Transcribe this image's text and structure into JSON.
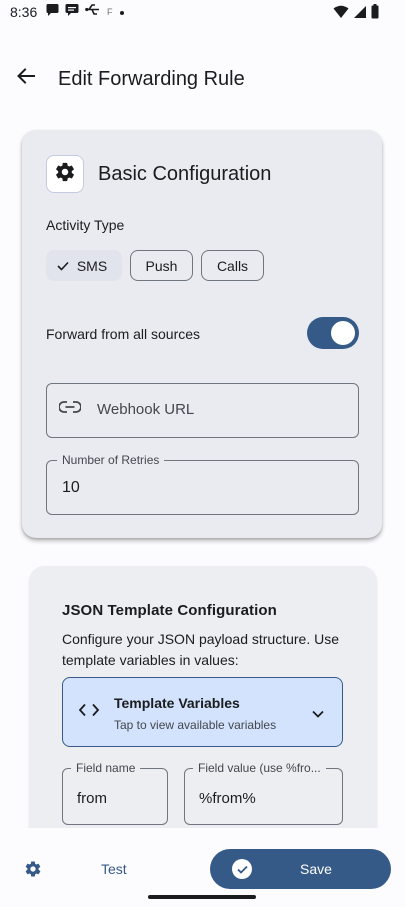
{
  "status_bar": {
    "time": "8:36",
    "left_icons": [
      "sms-icon",
      "chat-icon",
      "usb-icon",
      "f-icon",
      "dot-icon"
    ],
    "right_icons": [
      "wifi-icon",
      "signal-icon",
      "battery-icon"
    ]
  },
  "app_bar": {
    "title": "Edit Forwarding Rule",
    "back_icon": "arrow-back-icon"
  },
  "basic_config": {
    "title": "Basic Configuration",
    "icon": "gear-icon",
    "activity_type_label": "Activity Type",
    "chips": [
      {
        "label": "SMS",
        "selected": true
      },
      {
        "label": "Push",
        "selected": false
      },
      {
        "label": "Calls",
        "selected": false
      }
    ],
    "forward_all_label": "Forward from all sources",
    "forward_all_enabled": true,
    "webhook_placeholder": "Webhook URL",
    "retries_label": "Number of Retries",
    "retries_value": "10"
  },
  "json_config": {
    "title": "JSON Template Configuration",
    "description": "Configure your JSON payload structure. Use template variables in values:",
    "template_vars_title": "Template Variables",
    "template_vars_subtitle": "Tap to view available variables",
    "field_name_label": "Field name",
    "field_name_value": "from",
    "field_value_label": "Field value (use %fro...",
    "field_value_value": "%from%"
  },
  "bottom_bar": {
    "test_label": "Test",
    "save_label": "Save"
  },
  "colors": {
    "accent": "#355a87",
    "card_bg": "#e9ebf0",
    "chip_selected_bg": "#e1e4ec",
    "template_bg": "#d3e3fd"
  }
}
